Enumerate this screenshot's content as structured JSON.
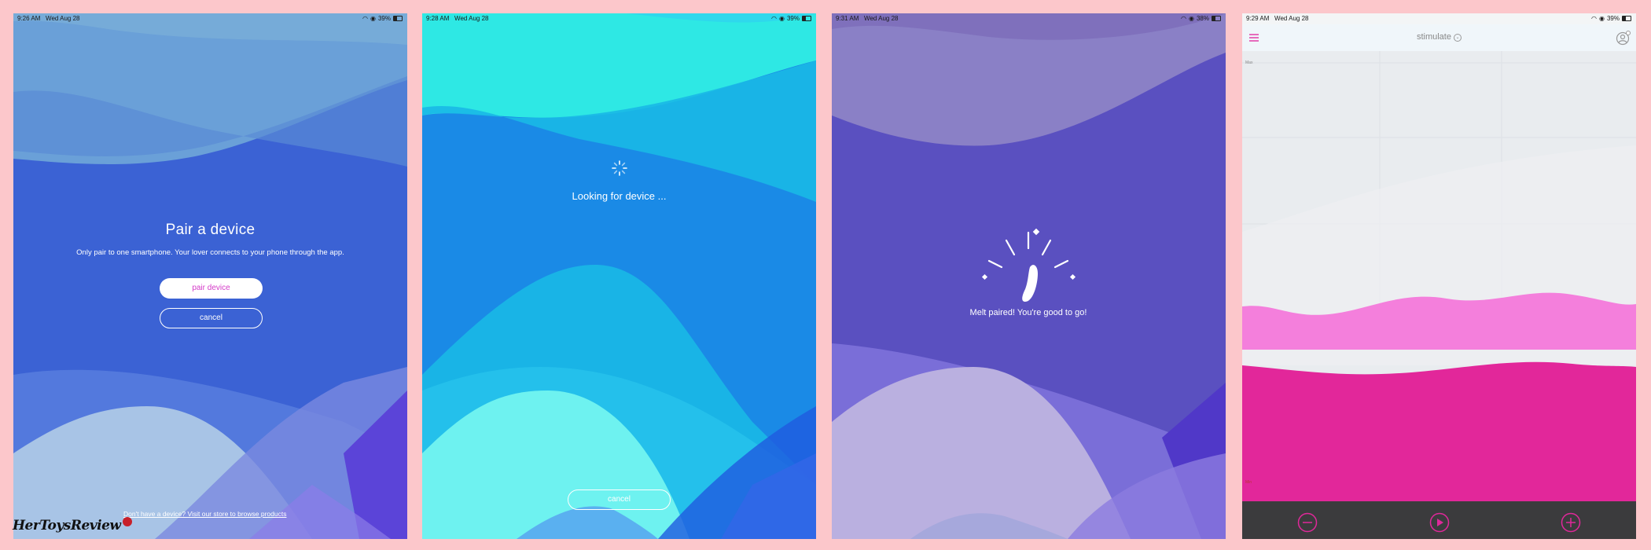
{
  "screens": [
    {
      "status": {
        "time": "9:26 AM",
        "date": "Wed Aug 28",
        "battery": "39%"
      },
      "title": "Pair a device",
      "subtitle": "Only pair to one smartphone. Your lover connects to your phone through the app.",
      "primary_button": "pair device",
      "secondary_button": "cancel",
      "footer_link": "Don't have a device? Visit our store to browse products",
      "colors": {
        "base": "#3a5ed0",
        "accent": "#e83ea8"
      }
    },
    {
      "status": {
        "time": "9:28 AM",
        "date": "Wed Aug 28",
        "battery": "39%"
      },
      "message": "Looking for device ...",
      "cancel_button": "cancel",
      "colors": {
        "base": "#1b8fe8",
        "accent": "#2ee8e8"
      }
    },
    {
      "status": {
        "time": "9:31 AM",
        "date": "Wed Aug 28",
        "battery": "38%"
      },
      "message": "Melt paired! You're good to go!",
      "colors": {
        "base": "#5a50c0"
      }
    },
    {
      "status": {
        "time": "9:29 AM",
        "date": "Wed Aug 28",
        "battery": "39%"
      },
      "nav_title": "stimulate",
      "chart_label_top": "Max",
      "chart_label_bottom": "Min",
      "toolbar": {
        "minus_icon": "minus-circle-icon",
        "play_icon": "play-circle-icon",
        "plus_icon": "plus-circle-icon"
      },
      "colors": {
        "accent": "#f05ab8",
        "wave_dark": "#e3299a",
        "toolbar_bg": "#3b3b3d"
      }
    }
  ],
  "watermark": "HerToysReview"
}
